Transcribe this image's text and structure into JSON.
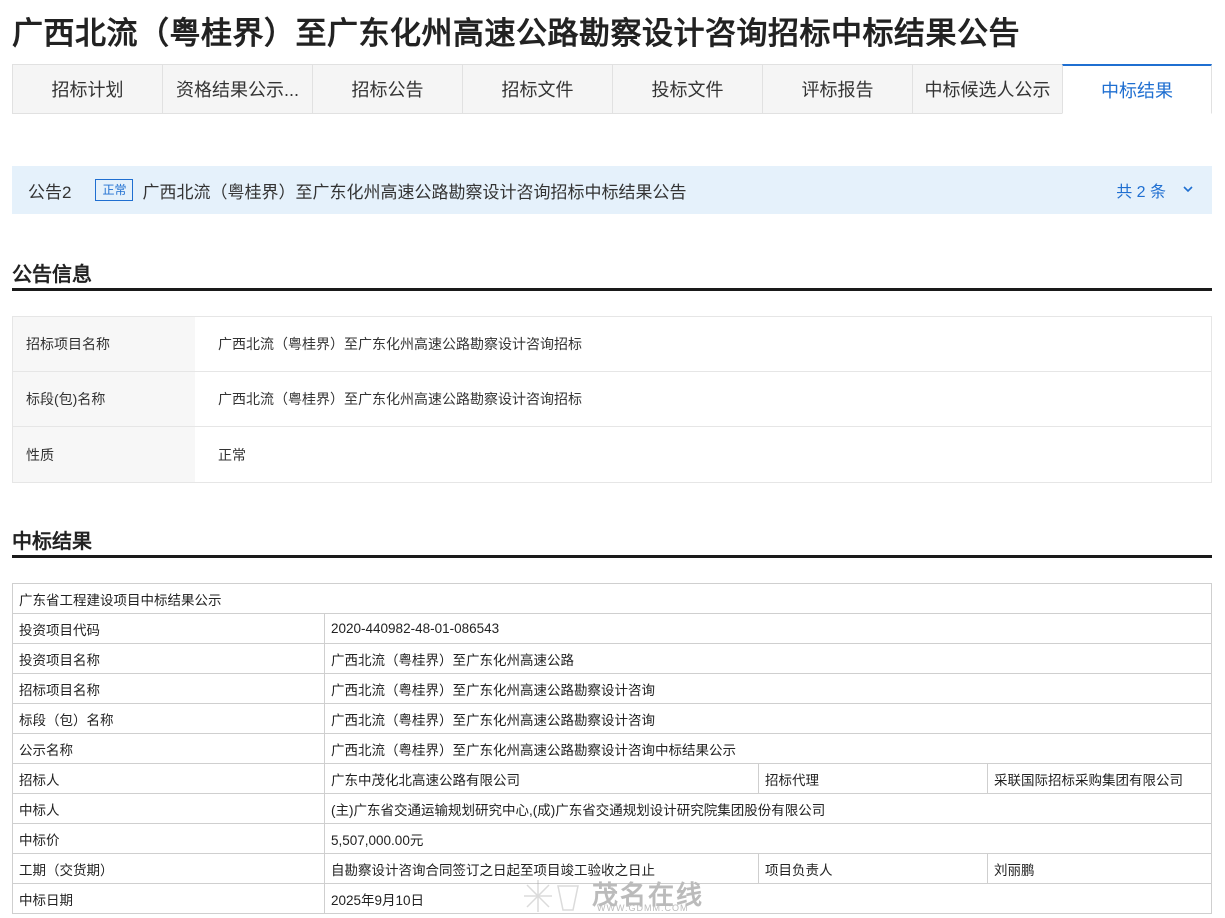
{
  "page": {
    "title": "广西北流（粤桂界）至广东化州高速公路勘察设计咨询招标中标结果公告"
  },
  "tabs": [
    {
      "label": "招标计划"
    },
    {
      "label": "资格结果公示..."
    },
    {
      "label": "招标公告"
    },
    {
      "label": "招标文件"
    },
    {
      "label": "投标文件"
    },
    {
      "label": "评标报告"
    },
    {
      "label": "中标候选人公示"
    },
    {
      "label": "中标结果"
    }
  ],
  "notice": {
    "number": "公告2",
    "badge": "正常",
    "title": "广西北流（粤桂界）至广东化州高速公路勘察设计咨询招标中标结果公告",
    "count": "共 2 条",
    "icon": "chevron-down-icon"
  },
  "info_section": {
    "title": "公告信息",
    "rows": [
      {
        "label": "招标项目名称",
        "value": "广西北流（粤桂界）至广东化州高速公路勘察设计咨询招标"
      },
      {
        "label": "标段(包)名称",
        "value": "广西北流（粤桂界）至广东化州高速公路勘察设计咨询招标"
      },
      {
        "label": "性质",
        "value": "正常"
      }
    ]
  },
  "result_section": {
    "title": "中标结果",
    "table_title": "广东省工程建设项目中标结果公示",
    "rows": {
      "project_code": {
        "label": "投资项目代码",
        "value": "2020-440982-48-01-086543"
      },
      "project_name": {
        "label": "投资项目名称",
        "value": "广西北流（粤桂界）至广东化州高速公路"
      },
      "bid_project_name": {
        "label": "招标项目名称",
        "value": "广西北流（粤桂界）至广东化州高速公路勘察设计咨询"
      },
      "section_name": {
        "label": "标段（包）名称",
        "value": "广西北流（粤桂界）至广东化州高速公路勘察设计咨询"
      },
      "notice_name": {
        "label": "公示名称",
        "value": "广西北流（粤桂界）至广东化州高速公路勘察设计咨询中标结果公示"
      },
      "tenderer": {
        "label": "招标人",
        "value": "广东中茂化北高速公路有限公司",
        "label2": "招标代理",
        "value2": "采联国际招标采购集团有限公司"
      },
      "winner": {
        "label": "中标人",
        "value": "(主)广东省交通运输规划研究中心,(成)广东省交通规划设计研究院集团股份有限公司"
      },
      "price": {
        "label": "中标价",
        "value": "5,507,000.00元"
      },
      "period": {
        "label": "工期（交货期）",
        "value": "自勘察设计咨询合同签订之日起至项目竣工验收之日止",
        "label2": "项目负责人",
        "value2": "刘丽鹏"
      },
      "date": {
        "label": "中标日期",
        "value": "2025年9月10日"
      }
    }
  },
  "watermark": {
    "text": "茂名在线",
    "url": "WWW.GDMM.COM"
  },
  "colors": {
    "accent": "#1f6fd1",
    "notice_bg": "#e5f1fb",
    "tab_bg": "#f5f5f5"
  }
}
